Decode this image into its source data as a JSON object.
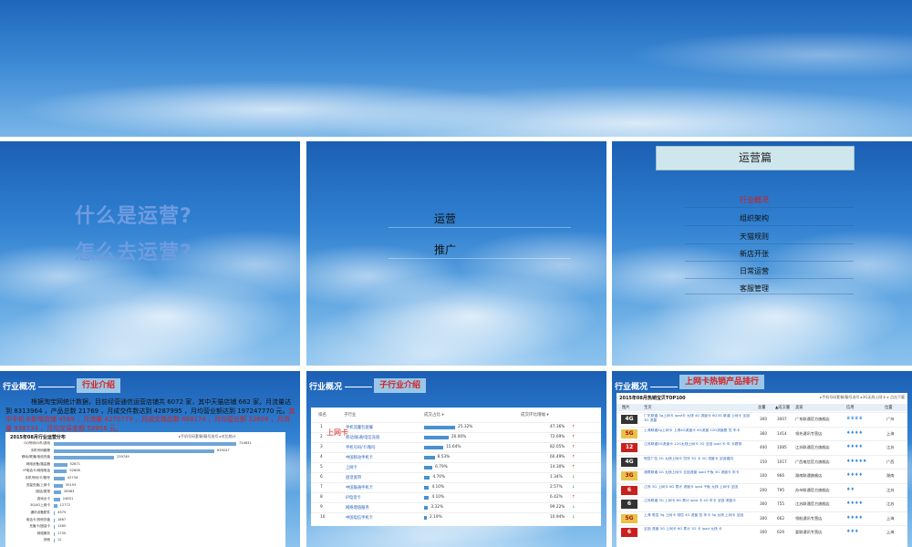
{
  "slide1": {
    "q1": "什么是运营?",
    "q2": "怎么去运营?"
  },
  "slide2": {
    "item1": "运营",
    "item2": "推广"
  },
  "slide3": {
    "title": "运营篇",
    "items": [
      "行业概况",
      "组织架构",
      "天猫规则",
      "新店开张",
      "日常运营",
      "客服管理"
    ]
  },
  "slide4": {
    "header_a": "行业概况",
    "header_b": "行业介绍",
    "para_main": "根据淘宝网统计数据，目前经营通信运营店铺共 6072 家，其中天猫店铺 662 家。月流量达到 8313964 ，产品总数 21769 ，月成交件数达到 4287995 ，月均营业额达到 197247770 元。",
    "para_red": "其中手机卡新增店铺 4569 ，月流量 4270779 ，月成交商品数 668174 ，月均营业额 32609 ，月流量 938734 ，月均交易金额 58956 元。",
    "panel_title": "2015年08月行业运营分布",
    "panel_tab": "▸手机号码套餐/靓号选号 ▸对比统计",
    "bars": [
      {
        "label": "QQ号码/Q币/游戏",
        "value": "724631",
        "fill": 1.0
      },
      {
        "label": "手机号码套餐",
        "value": "639247",
        "fill": 0.88
      },
      {
        "label": "移动/联通/电信充值",
        "value": "239749",
        "fill": 0.33
      },
      {
        "label": "网络设备/路由器",
        "value": "52871",
        "fill": 0.073
      },
      {
        "label": "IP电话卡/网络电话",
        "value": "52608",
        "fill": 0.072
      },
      {
        "label": "手机号码/卡/靓号",
        "value": "42734",
        "fill": 0.059
      },
      {
        "label": "流量充值/上网卡",
        "value": "35193",
        "fill": 0.049
      },
      {
        "label": "固话/宽带",
        "value": "28963",
        "fill": 0.04
      },
      {
        "label": "游戏点卡",
        "value": "24831",
        "fill": 0.034
      },
      {
        "label": "3G/4G上网卡",
        "value": "12772",
        "fill": 0.018
      },
      {
        "label": "通讯设备配件",
        "value": "4575",
        "fill": 0.006
      },
      {
        "label": "电话卡/其他充值",
        "value": "1867",
        "fill": 0.003
      },
      {
        "label": "充值卡/固话卡",
        "value": "1365",
        "fill": 0.002
      },
      {
        "label": "网络服务",
        "value": "1730",
        "fill": 0.002
      },
      {
        "label": "其他",
        "value": "12",
        "fill": 0.0
      }
    ]
  },
  "slide5": {
    "header_a": "行业概况",
    "header_b": "子行业介绍",
    "side_tag": "上网卡",
    "cols": [
      "排名",
      "子行业",
      "成交占比 ▾",
      "成交环比增幅 ▾"
    ],
    "rows": [
      {
        "rank": "1",
        "name": "手机流量包套餐",
        "pct": "25.32%",
        "fill": 1.0,
        "chg": "47.36%",
        "dir": "up"
      },
      {
        "rank": "2",
        "name": "移动/联通/电信充值",
        "pct": "20.00%",
        "fill": 0.79,
        "chg": "72.69%",
        "dir": "up"
      },
      {
        "rank": "3",
        "name": "手机号码/卡/靓号",
        "pct": "15.64%",
        "fill": 0.62,
        "chg": "82.05%",
        "dir": "up"
      },
      {
        "rank": "4",
        "name": "中国移动手机卡",
        "pct": "8.53%",
        "fill": 0.34,
        "chg": "60.49%",
        "dir": "up"
      },
      {
        "rank": "5",
        "name": "上网卡",
        "pct": "6.79%",
        "fill": 0.27,
        "chg": "14.30%",
        "dir": "up"
      },
      {
        "rank": "6",
        "name": "固话宽带",
        "pct": "4.70%",
        "fill": 0.19,
        "chg": "1.34%",
        "dir": "down"
      },
      {
        "rank": "7",
        "name": "中国联通手机卡",
        "pct": "4.10%",
        "fill": 0.16,
        "chg": "2.57%",
        "dir": "down"
      },
      {
        "rank": "8",
        "name": "IP电话卡",
        "pct": "4.10%",
        "fill": 0.16,
        "chg": "6.42%",
        "dir": "up"
      },
      {
        "rank": "9",
        "name": "网络增值服务",
        "pct": "3.32%",
        "fill": 0.13,
        "chg": "99.22%",
        "dir": "down"
      },
      {
        "rank": "10",
        "name": "中国电信手机卡",
        "pct": "2.19%",
        "fill": 0.09,
        "chg": "10.94%",
        "dir": "down"
      }
    ]
  },
  "slide6": {
    "header_a": "行业概况",
    "header_b": "上网卡热销产品排行",
    "panel_title": "2015年08月热销宝贝TOP100",
    "panel_right": "▸手机号码套餐/靓号选号 ▸3G无线上网卡 ▸ 点击下载",
    "cols": [
      "图片",
      "宝贝",
      "总量",
      "▲成交量",
      "卖家",
      "信用",
      "位置"
    ],
    "rows": [
      {
        "thumb": "4G",
        "title": "广东联通 3g上网卡 ipad卡 无线 4G 流量卡 6G3G 联通 上网卡 全国3G 流量",
        "total": "300",
        "sold": "3007",
        "seller": "广东联通官方旗舰店",
        "credit": "♛♛♛♛",
        "loc": "广州"
      },
      {
        "thumb": "5G",
        "title": "上海联通3g上网卡 上海4G流量卡 6G流量 12G流量套 包 年卡",
        "total": "360",
        "sold": "1414",
        "seller": "领先通讯专营店",
        "credit": "♦♦♦♦",
        "loc": "上海"
      },
      {
        "thumb": "12",
        "title": "江苏联通3G流量卡 12G无线上网卡 3G 全国 ipad 卡 年 卡套餐",
        "total": "400",
        "sold": "1085",
        "seller": "江苏联通官方旗舰店",
        "credit": "♦♦♦♦",
        "loc": "江苏"
      },
      {
        "thumb": "4G",
        "title": "电信广西 4G 无线上网卡 包年 3G 卡 4G 流量卡 全国通用",
        "total": "150",
        "sold": "1017",
        "seller": "广西电信官方旗舰店",
        "credit": "♦♦♦♦♦",
        "loc": "广西"
      },
      {
        "thumb": "3G",
        "title": "湖南联通 4G 无线上网卡 全国流量 ipad 平板 3G 流量卡 年卡",
        "total": "100",
        "sold": "966",
        "seller": "湖南联通旗舰店",
        "credit": "♦♦♦♦",
        "loc": "湖南"
      },
      {
        "thumb": "6",
        "title": "江苏 3G 上网卡 6G 累计 流量卡 ipad 平板 无线 上网卡 全国",
        "total": "200",
        "sold": "795",
        "seller": "苏州联通官方旗舰店",
        "credit": "♦♦",
        "loc": "江苏"
      },
      {
        "thumb": "6",
        "title": "江苏联通 3G 上网卡 6G 累计 ipad 卡 4G 年卡 全国 流量卡",
        "total": "300",
        "sold": "755",
        "seller": "江苏联通官方旗舰店",
        "credit": "♦♦♦♦",
        "loc": "江苏"
      },
      {
        "thumb": "5G",
        "title": "上海 电信 3g 上网卡 电信 4G 流量 包 年卡 3g 无线 上网卡 全国",
        "total": "300",
        "sold": "662",
        "seller": "领航通讯专营店",
        "credit": "♦♦♦♦",
        "loc": "上海"
      },
      {
        "thumb": "6",
        "title": "全国 流量 3G 上网卡 6G 累计 3G 卡 ipad 无线 卡",
        "total": "300",
        "sold": "629",
        "seller": "爱联通讯专营店",
        "credit": "♦♦♦",
        "loc": "上海"
      }
    ]
  }
}
